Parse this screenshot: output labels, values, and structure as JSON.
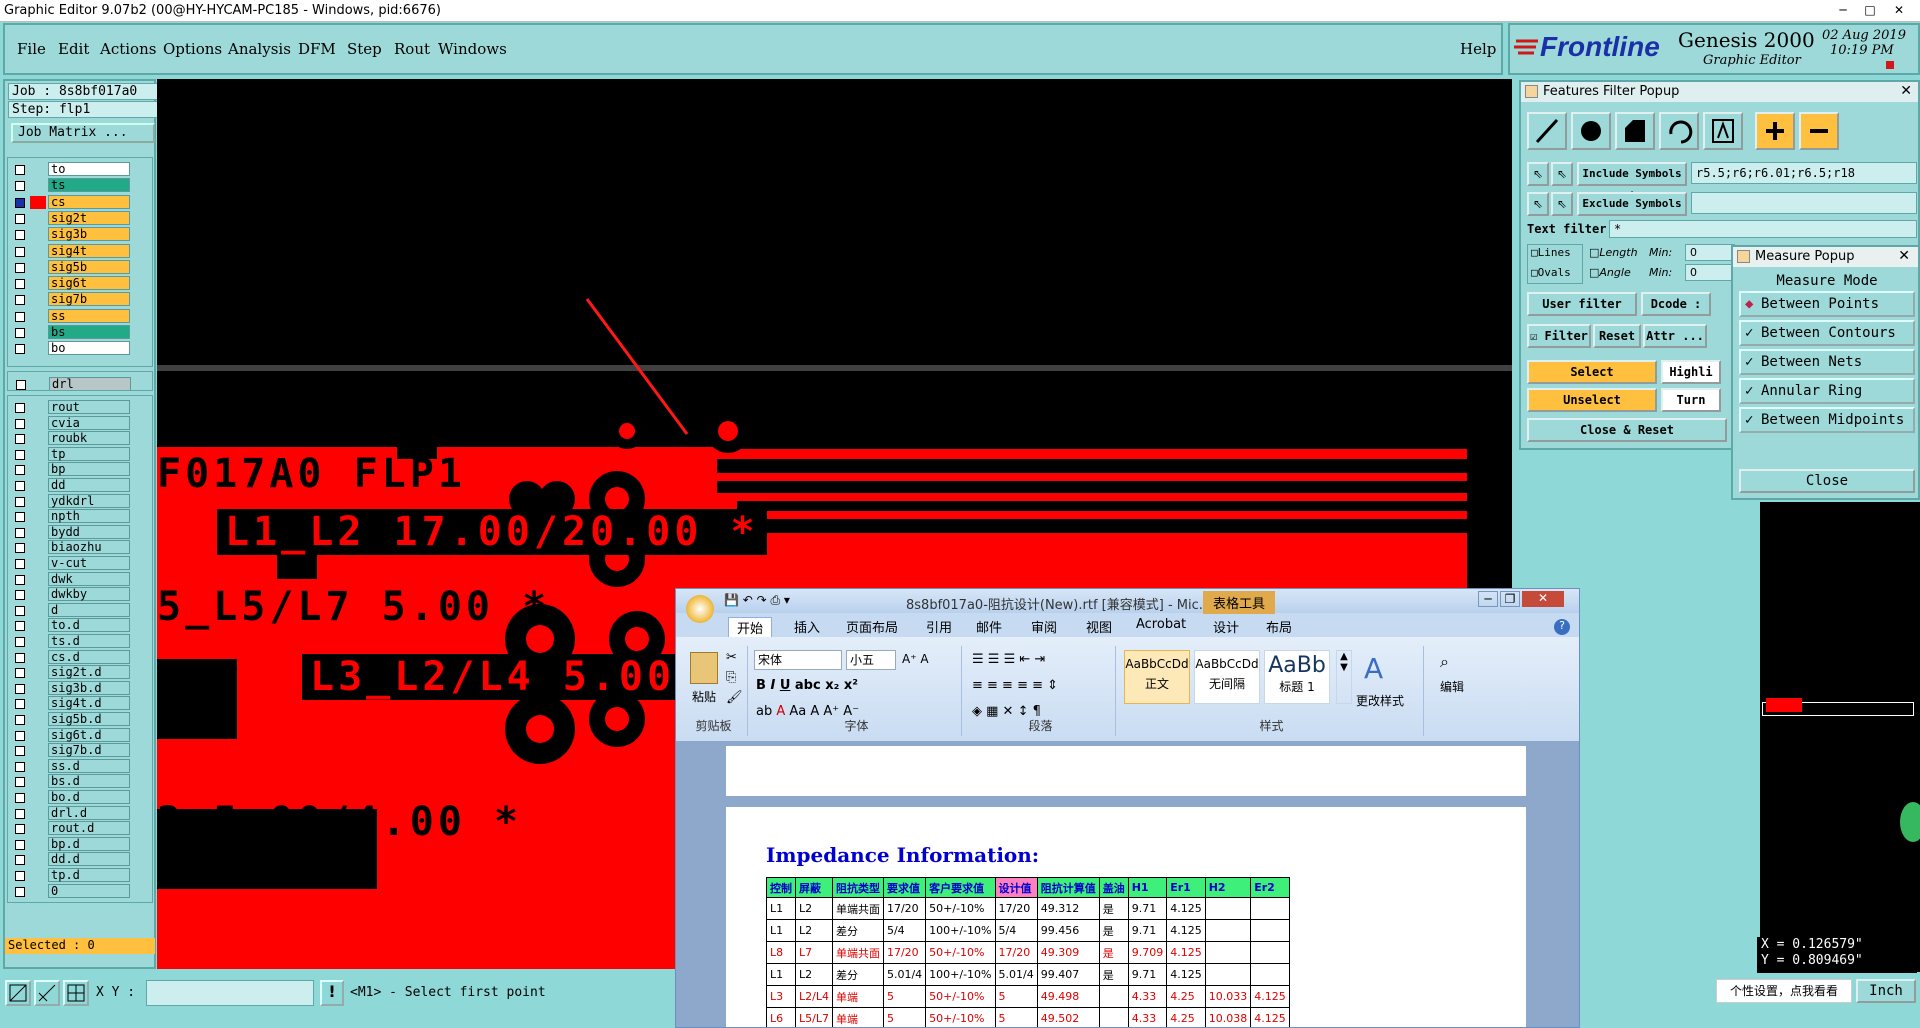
{
  "window": {
    "title": "Graphic Editor 9.07b2 (00@HY-HYCAM-PC185 - Windows, pid:6676)"
  },
  "menu": {
    "items": [
      "File",
      "Edit",
      "Actions",
      "Options",
      "Analysis",
      "DFM",
      "Step",
      "Rout",
      "Windows"
    ],
    "help": "Help"
  },
  "brand": {
    "logo": "Frontline",
    "product": "Genesis 2000",
    "subtitle": "Graphic Editor",
    "date": "02 Aug 2019",
    "time": "10:19 PM"
  },
  "job": {
    "job_label": "Job : 8s8bf017a0",
    "step_label": "Step: flp1",
    "matrix_button": "Job Matrix ..."
  },
  "layers_board": [
    {
      "name": "to",
      "color": "#ffffff"
    },
    {
      "name": "ts",
      "color": "#22aa88"
    },
    {
      "name": "cs",
      "color": "#ffc040"
    },
    {
      "name": "sig2t",
      "color": "#ffc040"
    },
    {
      "name": "sig3b",
      "color": "#ffc040"
    },
    {
      "name": "sig4t",
      "color": "#ffc040"
    },
    {
      "name": "sig5b",
      "color": "#ffc040"
    },
    {
      "name": "sig6t",
      "color": "#ffc040"
    },
    {
      "name": "sig7b",
      "color": "#ffc040"
    },
    {
      "name": "ss",
      "color": "#ffc040"
    },
    {
      "name": "bs",
      "color": "#22aa88"
    },
    {
      "name": "bo",
      "color": "#ffffff"
    }
  ],
  "layer_drill": "drl",
  "layers_misc": [
    "rout",
    "cvia",
    "roubk",
    "tp",
    "bp",
    "dd",
    "ydkdrl",
    "npth",
    "bydd",
    "biaozhu",
    "v-cut",
    "dwk",
    "dwkby",
    "d",
    "to.d",
    "ts.d",
    "cs.d",
    "sig2t.d",
    "sig3b.d",
    "sig4t.d",
    "sig5b.d",
    "sig6t.d",
    "sig7b.d",
    "ss.d",
    "bs.d",
    "bo.d",
    "drl.d",
    "rout.d",
    "bp.d",
    "dd.d",
    "tp.d",
    "0"
  ],
  "selected": "Selected : 0",
  "canvas_text": {
    "line1": "F017A0 FLP1",
    "line2": "L1_L2 17.00/20.00 *",
    "line3": "5_L5/L7 5.00 *",
    "line4": "L3_L2/L4 5.00 *",
    "line5": "2 5.00/4.00 *"
  },
  "features_filter": {
    "title": "Features Filter Popup",
    "include_label": "Include Symbols :",
    "include_value": "r5.5;r6;r6.01;r6.5;r18",
    "exclude_label": "Exclude Symbols :",
    "text_filter_label": "Text filter",
    "text_filter_value": "*",
    "lines": "Lines",
    "ovals": "Ovals",
    "length": "Length",
    "angle": "Angle",
    "min": "Min:",
    "min_val": "0",
    "user_filter": "User filter ...",
    "dcode": "Dcode :",
    "filter": "Filter",
    "reset": "Reset",
    "attr": "Attr ...",
    "select": "Select",
    "unselect": "Unselect",
    "highlight": "Highli",
    "turn": "Turn",
    "close_reset": "Close & Reset"
  },
  "measure": {
    "title": "Measure Popup",
    "mode_label": "Measure Mode",
    "options": [
      "Between Points",
      "Between Contours",
      "Between Nets",
      "Annular Ring",
      "Between Midpoints"
    ],
    "close": "Close"
  },
  "coords": {
    "x": "X = 0.126579\"",
    "y": "Y = 0.809469\""
  },
  "status": {
    "xy_label": "X Y :",
    "prompt": "<M1> - Select first point",
    "units": "Inch",
    "ime_hint": "个性设置，点我看看"
  },
  "word": {
    "title": "8s8bf017a0-阻抗设计(New).rtf [兼容模式] - Mic...",
    "context_tab": "表格工具",
    "tabs": [
      "开始",
      "插入",
      "页面布局",
      "引用",
      "邮件",
      "审阅",
      "视图",
      "Acrobat",
      "设计",
      "布局"
    ],
    "clipboard": {
      "paste": "粘贴",
      "label": "剪贴板"
    },
    "font": {
      "name": "宋体",
      "size": "小五",
      "label": "字体"
    },
    "paragraph_label": "段落",
    "styles": {
      "s1_sample": "AaBbCcDd",
      "s1": "正文",
      "s2_sample": "AaBbCcDd",
      "s2": "无间隔",
      "s3_sample": "AaBb",
      "s3": "标题 1",
      "change": "更改样式",
      "label": "样式"
    },
    "edit": "编辑",
    "doc_heading": "Impedance Information:",
    "table_header": [
      "控制",
      "屏蔽",
      "阻抗类型",
      "要求值",
      "客户要求值",
      "设计值",
      "阻抗计算值",
      "盖油",
      "H1",
      "Er1",
      "H2",
      "Er2"
    ],
    "table_rows": [
      {
        "red": false,
        "cells": [
          "L1",
          "L2",
          "单端共面",
          "17/20",
          "50+/-10%",
          "17/20",
          "49.312",
          "是",
          "9.71",
          "4.125",
          "",
          ""
        ]
      },
      {
        "red": false,
        "cells": [
          "L1",
          "L2",
          "差分",
          "5/4",
          "100+/-10%",
          "5/4",
          "99.456",
          "是",
          "9.71",
          "4.125",
          "",
          ""
        ]
      },
      {
        "red": true,
        "cells": [
          "L8",
          "L7",
          "单端共面",
          "17/20",
          "50+/-10%",
          "17/20",
          "49.309",
          "是",
          "9.709",
          "4.125",
          "",
          ""
        ]
      },
      {
        "red": false,
        "cells": [
          "L1",
          "L2",
          "差分",
          "5.01/4",
          "100+/-10%",
          "5.01/4",
          "99.407",
          "是",
          "9.71",
          "4.125",
          "",
          ""
        ]
      },
      {
        "red": true,
        "cells": [
          "L3",
          "L2/L4",
          "单端",
          "5",
          "50+/-10%",
          "5",
          "49.498",
          "",
          "4.33",
          "4.25",
          "10.033",
          "4.125"
        ]
      },
      {
        "red": true,
        "cells": [
          "L6",
          "L5/L7",
          "单端",
          "5",
          "50+/-10%",
          "5",
          "49.502",
          "",
          "4.33",
          "4.25",
          "10.038",
          "4.125"
        ]
      }
    ]
  }
}
